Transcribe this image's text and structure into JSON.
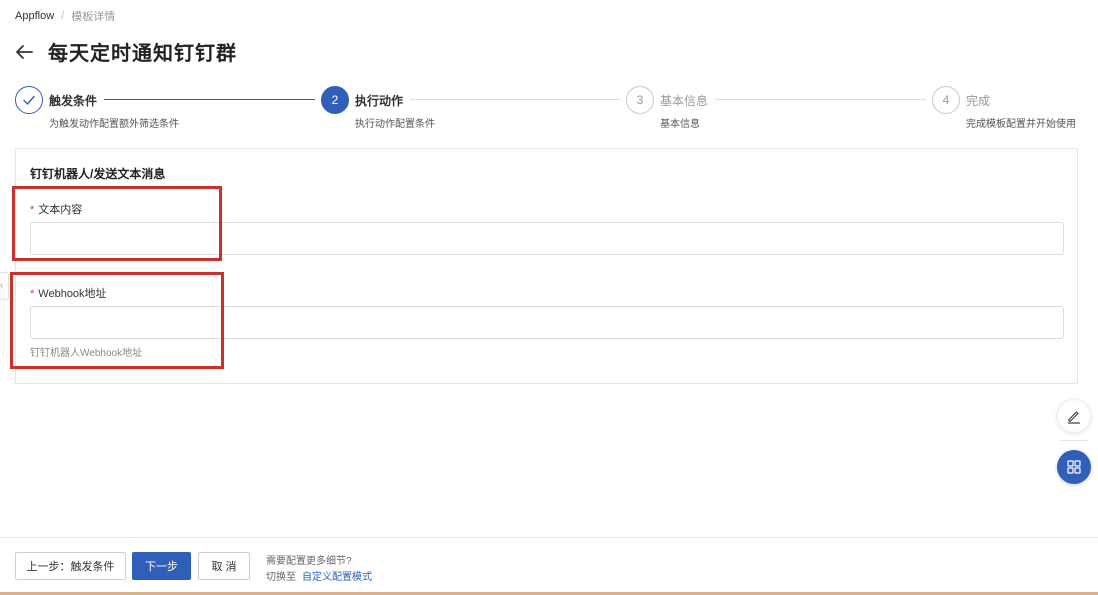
{
  "breadcrumb": {
    "home": "Appflow",
    "separator": "/",
    "current": "模板详情"
  },
  "page": {
    "title": "每天定时通知钉钉群"
  },
  "steps": [
    {
      "index": "",
      "title": "触发条件",
      "desc": "为触发动作配置额外筛选条件",
      "status": "done"
    },
    {
      "index": "2",
      "title": "执行动作",
      "desc": "执行动作配置条件",
      "status": "active"
    },
    {
      "index": "3",
      "title": "基本信息",
      "desc": "基本信息",
      "status": "todo"
    },
    {
      "index": "4",
      "title": "完成",
      "desc": "完成模板配置并开始使用",
      "status": "todo"
    }
  ],
  "panel": {
    "title": "钉钉机器人/发送文本消息",
    "fields": [
      {
        "required_mark": "*",
        "label": "文本内容",
        "value": "",
        "help": ""
      },
      {
        "required_mark": "*",
        "label": "Webhook地址",
        "value": "",
        "help": "钉钉机器人Webhook地址"
      }
    ]
  },
  "footer": {
    "prev_label": "上一步：触发条件",
    "next_label": "下一步",
    "cancel_label": "取 消",
    "hint_question": "需要配置更多细节?",
    "hint_prefix": "切换至",
    "hint_link": "自定义配置模式"
  },
  "side_tab": {
    "glyph": "‹"
  },
  "icons": {
    "back": "arrow-left-icon",
    "done": "check-icon",
    "edit": "pencil-icon",
    "apps": "grid-icon"
  },
  "colors": {
    "primary": "#2f5fb8",
    "required": "#d9363e",
    "highlight": "#c8322a",
    "border": "#dcdcdc"
  }
}
